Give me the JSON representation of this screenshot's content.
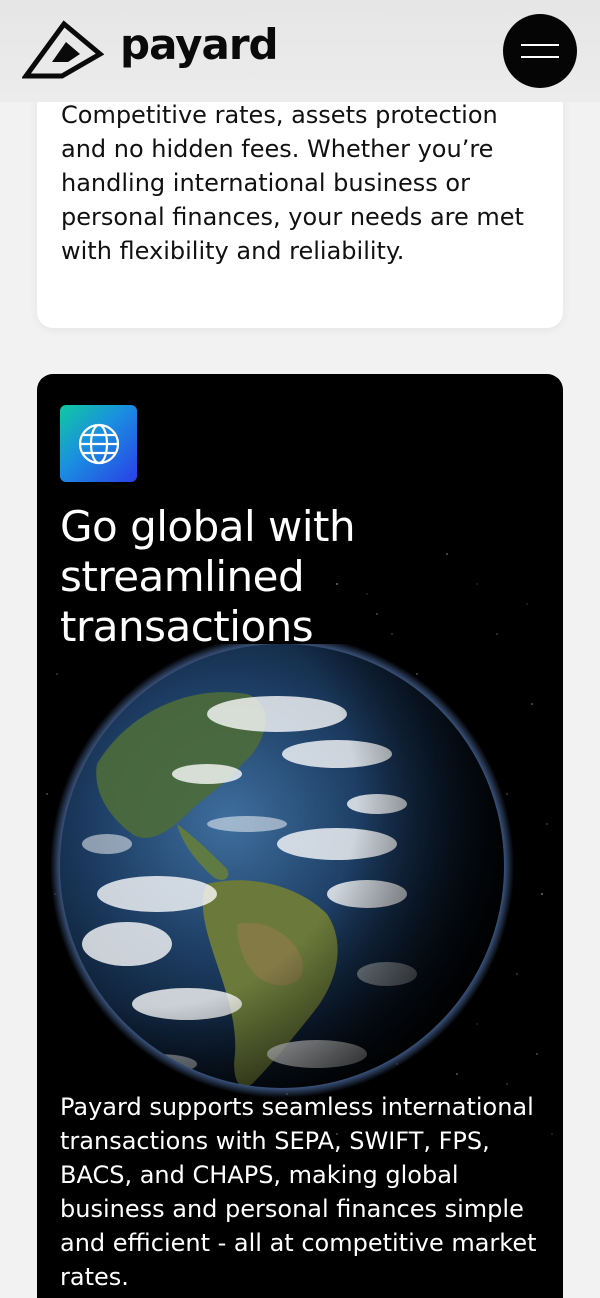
{
  "header": {
    "brand": "payard",
    "logo_icon": "payard-logo-icon",
    "menu_icon": "hamburger-menu-icon"
  },
  "card_features": {
    "body": "Competitive rates, assets protection and no hidden fees. Whether you’re handling international business or personal finances, your needs are met with flexibility and reliability."
  },
  "card_global": {
    "icon": "globe-icon",
    "title": "Go global with streamlined transactions",
    "body": "Payard supports seamless international transactions with SEPA, SWIFT, FPS, BACS, and CHAPS, making global business and personal finances simple and efficient - all at competitive market rates.",
    "image": "earth-from-space"
  },
  "colors": {
    "background": "#f2f2f2",
    "card_dark": "#000000",
    "icon_gradient_start": "#10c9a0",
    "icon_gradient_end": "#2a3fe8"
  }
}
